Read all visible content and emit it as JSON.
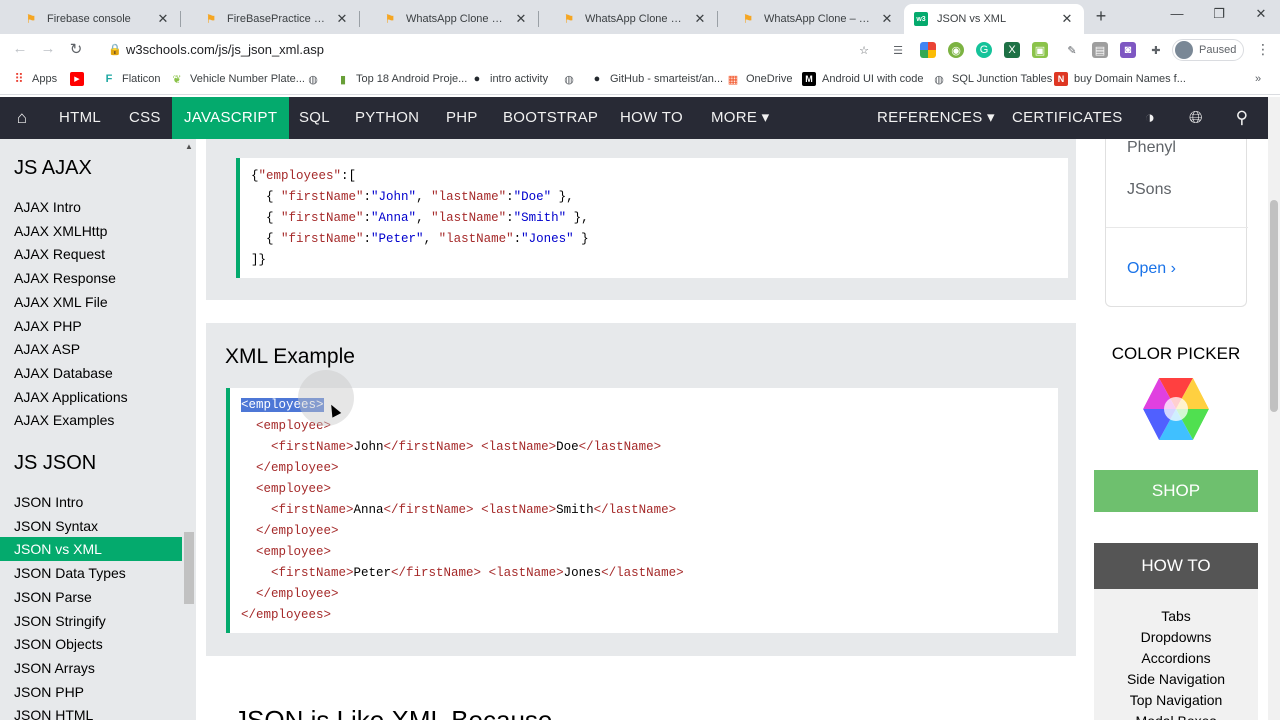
{
  "browser": {
    "tabs": [
      {
        "title": "Firebase console",
        "icon": "firebase-icon",
        "active": false
      },
      {
        "title": "FireBasePractice – Firebase c",
        "icon": "firebase-icon",
        "active": false
      },
      {
        "title": "WhatsApp Clone – WhatsAp",
        "icon": "firebase-icon",
        "active": false
      },
      {
        "title": "WhatsApp Clone – Firebase",
        "icon": "firebase-icon",
        "active": false
      },
      {
        "title": "WhatsApp Clone – Firebase",
        "icon": "firebase-icon",
        "active": false
      },
      {
        "title": "JSON vs XML",
        "icon": "w3schools-icon",
        "active": true
      }
    ],
    "favicon_w3": "w3",
    "new_tab": "+",
    "close_glyph": "✕",
    "window_controls": {
      "minimize": "—",
      "maximize": "❐",
      "close": "✕"
    },
    "url": "w3schools.com/js/js_json_xml.asp",
    "profile_status": "Paused",
    "bookmarks": [
      {
        "label": "Apps",
        "icon": "apps-grid-icon"
      },
      {
        "label": "",
        "icon": "youtube-icon"
      },
      {
        "label": "Flaticon",
        "icon": "flaticon-icon"
      },
      {
        "label": "Vehicle Number Plate...",
        "icon": "leaf-icon"
      },
      {
        "label": "",
        "icon": "globe-icon"
      },
      {
        "label": "Top 18 Android Proje...",
        "icon": "bookmark-icon"
      },
      {
        "label": "intro activity",
        "icon": "github-icon"
      },
      {
        "label": "",
        "icon": "globe-icon"
      },
      {
        "label": "GitHub - smarteist/an...",
        "icon": "github-icon"
      },
      {
        "label": "OneDrive",
        "icon": "microsoft-icon"
      },
      {
        "label": "Android UI with code",
        "icon": "medium-icon"
      },
      {
        "label": "SQL Junction Tables",
        "icon": "globe-icon"
      },
      {
        "label": "buy Domain Names f...",
        "icon": "namecheap-icon"
      }
    ],
    "bookmarks_more": "»",
    "colors": {
      "tabstrip": "#dee1e6",
      "active_tab": "#ffffff"
    }
  },
  "topnav": {
    "items": [
      "HTML",
      "CSS",
      "JAVASCRIPT",
      "SQL",
      "PYTHON",
      "PHP",
      "BOOTSTRAP",
      "HOW TO",
      "MORE ▾"
    ],
    "active": "JAVASCRIPT",
    "right_items": [
      "REFERENCES ▾",
      "CERTIFICATES"
    ],
    "icons": [
      "home-icon",
      "contrast-icon",
      "globe-icon",
      "search-icon"
    ],
    "colors": {
      "bg": "#282a35",
      "accent": "#04aa6d"
    }
  },
  "sidebar": {
    "sections": [
      {
        "heading": "JS AJAX",
        "items": [
          "AJAX Intro",
          "AJAX XMLHttp",
          "AJAX Request",
          "AJAX Response",
          "AJAX XML File",
          "AJAX PHP",
          "AJAX ASP",
          "AJAX Database",
          "AJAX Applications",
          "AJAX Examples"
        ]
      },
      {
        "heading": "JS JSON",
        "items": [
          "JSON Intro",
          "JSON Syntax",
          "JSON vs XML",
          "JSON Data Types",
          "JSON Parse",
          "JSON Stringify",
          "JSON Objects",
          "JSON Arrays",
          "JSON PHP",
          "JSON HTML"
        ]
      }
    ],
    "active_item": "JSON vs XML"
  },
  "main": {
    "json_example_lines": [
      [
        {
          "t": "{",
          "c": "br"
        },
        {
          "t": "\"employees\"",
          "c": "key"
        },
        {
          "t": ":[",
          "c": "br"
        }
      ],
      [
        {
          "t": "  { ",
          "c": "br"
        },
        {
          "t": "\"firstName\"",
          "c": "key"
        },
        {
          "t": ":",
          "c": "br"
        },
        {
          "t": "\"John\"",
          "c": "str"
        },
        {
          "t": ", ",
          "c": "br"
        },
        {
          "t": "\"lastName\"",
          "c": "key"
        },
        {
          "t": ":",
          "c": "br"
        },
        {
          "t": "\"Doe\"",
          "c": "str"
        },
        {
          "t": " },",
          "c": "br"
        }
      ],
      [
        {
          "t": "  { ",
          "c": "br"
        },
        {
          "t": "\"firstName\"",
          "c": "key"
        },
        {
          "t": ":",
          "c": "br"
        },
        {
          "t": "\"Anna\"",
          "c": "str"
        },
        {
          "t": ", ",
          "c": "br"
        },
        {
          "t": "\"lastName\"",
          "c": "key"
        },
        {
          "t": ":",
          "c": "br"
        },
        {
          "t": "\"Smith\"",
          "c": "str"
        },
        {
          "t": " },",
          "c": "br"
        }
      ],
      [
        {
          "t": "  { ",
          "c": "br"
        },
        {
          "t": "\"firstName\"",
          "c": "key"
        },
        {
          "t": ":",
          "c": "br"
        },
        {
          "t": "\"Peter\"",
          "c": "str"
        },
        {
          "t": ", ",
          "c": "br"
        },
        {
          "t": "\"lastName\"",
          "c": "key"
        },
        {
          "t": ":",
          "c": "br"
        },
        {
          "t": "\"Jones\"",
          "c": "str"
        },
        {
          "t": " }",
          "c": "br"
        }
      ],
      [
        {
          "t": "]}",
          "c": "br"
        }
      ]
    ],
    "xml_heading": "XML Example",
    "xml_example_lines": [
      [
        {
          "t": "<employees>",
          "c": "tag",
          "selected": true
        }
      ],
      [
        {
          "t": "  <employee>",
          "c": "tag"
        }
      ],
      [
        {
          "t": "    <firstName>",
          "c": "tag"
        },
        {
          "t": "John",
          "c": "txt"
        },
        {
          "t": "</firstName>",
          "c": "tag"
        },
        {
          "t": " ",
          "c": "txt"
        },
        {
          "t": "<lastName>",
          "c": "tag"
        },
        {
          "t": "Doe",
          "c": "txt"
        },
        {
          "t": "</lastName>",
          "c": "tag"
        }
      ],
      [
        {
          "t": "  </employee>",
          "c": "tag"
        }
      ],
      [
        {
          "t": "  <employee>",
          "c": "tag"
        }
      ],
      [
        {
          "t": "    <firstName>",
          "c": "tag"
        },
        {
          "t": "Anna",
          "c": "txt"
        },
        {
          "t": "</firstName>",
          "c": "tag"
        },
        {
          "t": " ",
          "c": "txt"
        },
        {
          "t": "<lastName>",
          "c": "tag"
        },
        {
          "t": "Smith",
          "c": "txt"
        },
        {
          "t": "</lastName>",
          "c": "tag"
        }
      ],
      [
        {
          "t": "  </employee>",
          "c": "tag"
        }
      ],
      [
        {
          "t": "  <employee>",
          "c": "tag"
        }
      ],
      [
        {
          "t": "    <firstName>",
          "c": "tag"
        },
        {
          "t": "Peter",
          "c": "txt"
        },
        {
          "t": "</firstName>",
          "c": "tag"
        },
        {
          "t": " ",
          "c": "txt"
        },
        {
          "t": "<lastName>",
          "c": "tag"
        },
        {
          "t": "Jones",
          "c": "txt"
        },
        {
          "t": "</lastName>",
          "c": "tag"
        }
      ],
      [
        {
          "t": "  </employee>",
          "c": "tag"
        }
      ],
      [
        {
          "t": "</employees>",
          "c": "tag"
        }
      ]
    ],
    "next_heading": "JSON is Like XML Because",
    "colors": {
      "tag": "#a52a2a",
      "string": "#0000cd",
      "selection": "#4d77d6"
    }
  },
  "right": {
    "ad_texts": [
      "Phenyl",
      "JSons"
    ],
    "ad_open": "Open ›",
    "color_picker_title": "COLOR PICKER",
    "shop": "SHOP",
    "howto_title": "HOW TO",
    "howto_links": [
      "Tabs",
      "Dropdowns",
      "Accordions",
      "Side Navigation",
      "Top Navigation",
      "Modal Boxes"
    ],
    "colors": {
      "shop": "#6ec06e",
      "howto": "#555555"
    }
  }
}
